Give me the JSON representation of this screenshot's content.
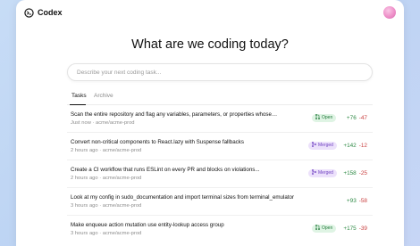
{
  "app": {
    "title": "Codex"
  },
  "header": {
    "heading": "What are we coding today?"
  },
  "search": {
    "placeholder": "Describe your next coding task..."
  },
  "tabs": [
    {
      "label": "Tasks",
      "active": true
    },
    {
      "label": "Archive",
      "active": false
    }
  ],
  "tasks": [
    {
      "title": "Scan the entire repository and flag any variables, parameters, or properties whose names are v...",
      "meta": "Just now · acme/acme-prod",
      "status": "Open",
      "additions": "+76",
      "deletions": "-47"
    },
    {
      "title": "Convert non-critical components to React.lazy with Suspense fallbacks",
      "meta": "2 hours ago · acme/acme-prod",
      "status": "Merged",
      "additions": "+142",
      "deletions": "-12"
    },
    {
      "title": "Create a CI workflow that runs ESLint on every PR and blocks on violations...",
      "meta": "2 hours ago · acme/acme-prod",
      "status": "Merged",
      "additions": "+158",
      "deletions": "-25"
    },
    {
      "title": "Look at my config in sudo_documentation and import terminal sizes from terminal_emulator",
      "meta": "3 hours ago · acme/acme-prod",
      "status": "",
      "additions": "+93",
      "deletions": "-58"
    },
    {
      "title": "Make enqueue action mutation use entity-lookup access group",
      "meta": "3 hours ago · acme/acme-prod",
      "status": "Open",
      "additions": "+175",
      "deletions": "-39"
    }
  ],
  "colors": {
    "background": "#c5d9f5",
    "open_badge_bg": "#dff4e4",
    "open_badge_text": "#237a3b",
    "merged_badge_bg": "#ece1fb",
    "merged_badge_text": "#7042c2",
    "additions": "#2f8a46",
    "deletions": "#c94040"
  },
  "icons": {
    "logo": "codex-logo-icon",
    "open_status": "pull-request-icon",
    "merged_status": "merge-icon"
  }
}
